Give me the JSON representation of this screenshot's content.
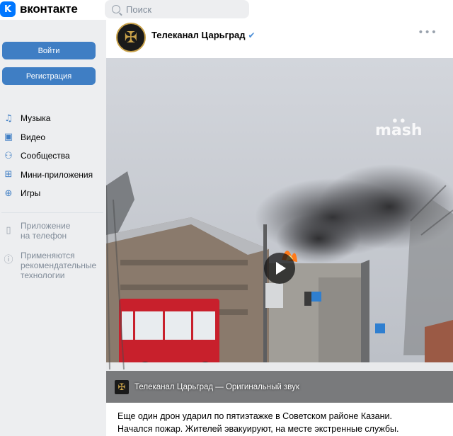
{
  "header": {
    "logo_mark": "K",
    "logo_text": "вконтакте",
    "search_placeholder": "Поиск"
  },
  "sidebar": {
    "login_label": "Войти",
    "register_label": "Регистрация",
    "items": [
      {
        "label": "Музыка",
        "icon": "music-icon",
        "glyph": "♫"
      },
      {
        "label": "Видео",
        "icon": "video-icon",
        "glyph": "▣"
      },
      {
        "label": "Сообщества",
        "icon": "communities-icon",
        "glyph": "⚇"
      },
      {
        "label": "Мини-приложения",
        "icon": "apps-icon",
        "glyph": "⊞"
      },
      {
        "label": "Игры",
        "icon": "gamepad-icon",
        "glyph": "⊕"
      }
    ],
    "secondary": [
      {
        "label_line1": "Приложение",
        "label_line2": "на телефон",
        "icon": "phone-icon",
        "glyph": "▯"
      },
      {
        "label_line1": "Применяются",
        "label_line2": "рекомендательные",
        "label_line3": "технологии",
        "icon": "info-icon",
        "glyph": "ⓘ"
      }
    ]
  },
  "post": {
    "author": "Телеканал Царьград",
    "verified_glyph": "✔",
    "more_glyph": "•••",
    "video": {
      "watermark": "mash",
      "caption": "Телеканал Царьград — Оригинальный звук"
    },
    "text_line1": "Еще один дрон ударил по пятиэтажке в Советском районе Казани.",
    "text_line2": "Начался пожар. Жителей эвакуируют, на месте экстренные службы."
  }
}
